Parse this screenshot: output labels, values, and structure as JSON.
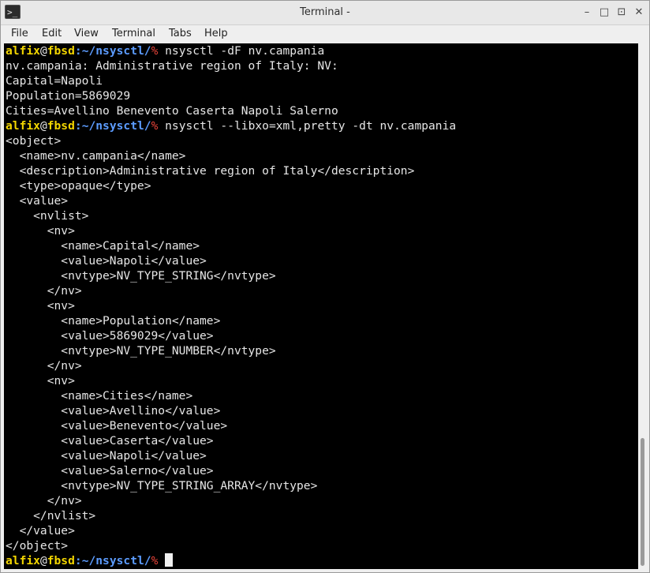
{
  "window": {
    "title": "Terminal -",
    "icon": "terminal-icon",
    "controls": {
      "minimize": "–",
      "restore": "□",
      "maximize": "⊡",
      "close": "✕"
    }
  },
  "menu": [
    "File",
    "Edit",
    "View",
    "Terminal",
    "Tabs",
    "Help"
  ],
  "prompt": {
    "user": "alfix",
    "at": "@",
    "host": "fbsd",
    "sep": ":",
    "path": "~/nsysctl/",
    "symbol": "%"
  },
  "colors": {
    "prompt_user": "#f2d500",
    "prompt_path": "#5c9cff",
    "prompt_symbol": "#e8443a",
    "terminal_bg": "#000000",
    "terminal_fg": "#e6e6e6"
  },
  "lines": [
    {
      "type": "prompt",
      "cmd": " nsysctl -dF nv.campania"
    },
    {
      "type": "out",
      "text": "nv.campania: Administrative region of Italy: NV:"
    },
    {
      "type": "out",
      "text": "Capital=Napoli"
    },
    {
      "type": "out",
      "text": "Population=5869029"
    },
    {
      "type": "out",
      "text": "Cities=Avellino Benevento Caserta Napoli Salerno"
    },
    {
      "type": "prompt",
      "cmd": " nsysctl --libxo=xml,pretty -dt nv.campania"
    },
    {
      "type": "out",
      "text": "<object>"
    },
    {
      "type": "out",
      "text": "  <name>nv.campania</name>"
    },
    {
      "type": "out",
      "text": "  <description>Administrative region of Italy</description>"
    },
    {
      "type": "out",
      "text": "  <type>opaque</type>"
    },
    {
      "type": "out",
      "text": "  <value>"
    },
    {
      "type": "out",
      "text": "    <nvlist>"
    },
    {
      "type": "out",
      "text": "      <nv>"
    },
    {
      "type": "out",
      "text": "        <name>Capital</name>"
    },
    {
      "type": "out",
      "text": "        <value>Napoli</value>"
    },
    {
      "type": "out",
      "text": "        <nvtype>NV_TYPE_STRING</nvtype>"
    },
    {
      "type": "out",
      "text": "      </nv>"
    },
    {
      "type": "out",
      "text": "      <nv>"
    },
    {
      "type": "out",
      "text": "        <name>Population</name>"
    },
    {
      "type": "out",
      "text": "        <value>5869029</value>"
    },
    {
      "type": "out",
      "text": "        <nvtype>NV_TYPE_NUMBER</nvtype>"
    },
    {
      "type": "out",
      "text": "      </nv>"
    },
    {
      "type": "out",
      "text": "      <nv>"
    },
    {
      "type": "out",
      "text": "        <name>Cities</name>"
    },
    {
      "type": "out",
      "text": "        <value>Avellino</value>"
    },
    {
      "type": "out",
      "text": "        <value>Benevento</value>"
    },
    {
      "type": "out",
      "text": "        <value>Caserta</value>"
    },
    {
      "type": "out",
      "text": "        <value>Napoli</value>"
    },
    {
      "type": "out",
      "text": "        <value>Salerno</value>"
    },
    {
      "type": "out",
      "text": "        <nvtype>NV_TYPE_STRING_ARRAY</nvtype>"
    },
    {
      "type": "out",
      "text": "      </nv>"
    },
    {
      "type": "out",
      "text": "    </nvlist>"
    },
    {
      "type": "out",
      "text": "  </value>"
    },
    {
      "type": "out",
      "text": "</object>"
    },
    {
      "type": "prompt",
      "cmd": " ",
      "cursor": true
    }
  ]
}
